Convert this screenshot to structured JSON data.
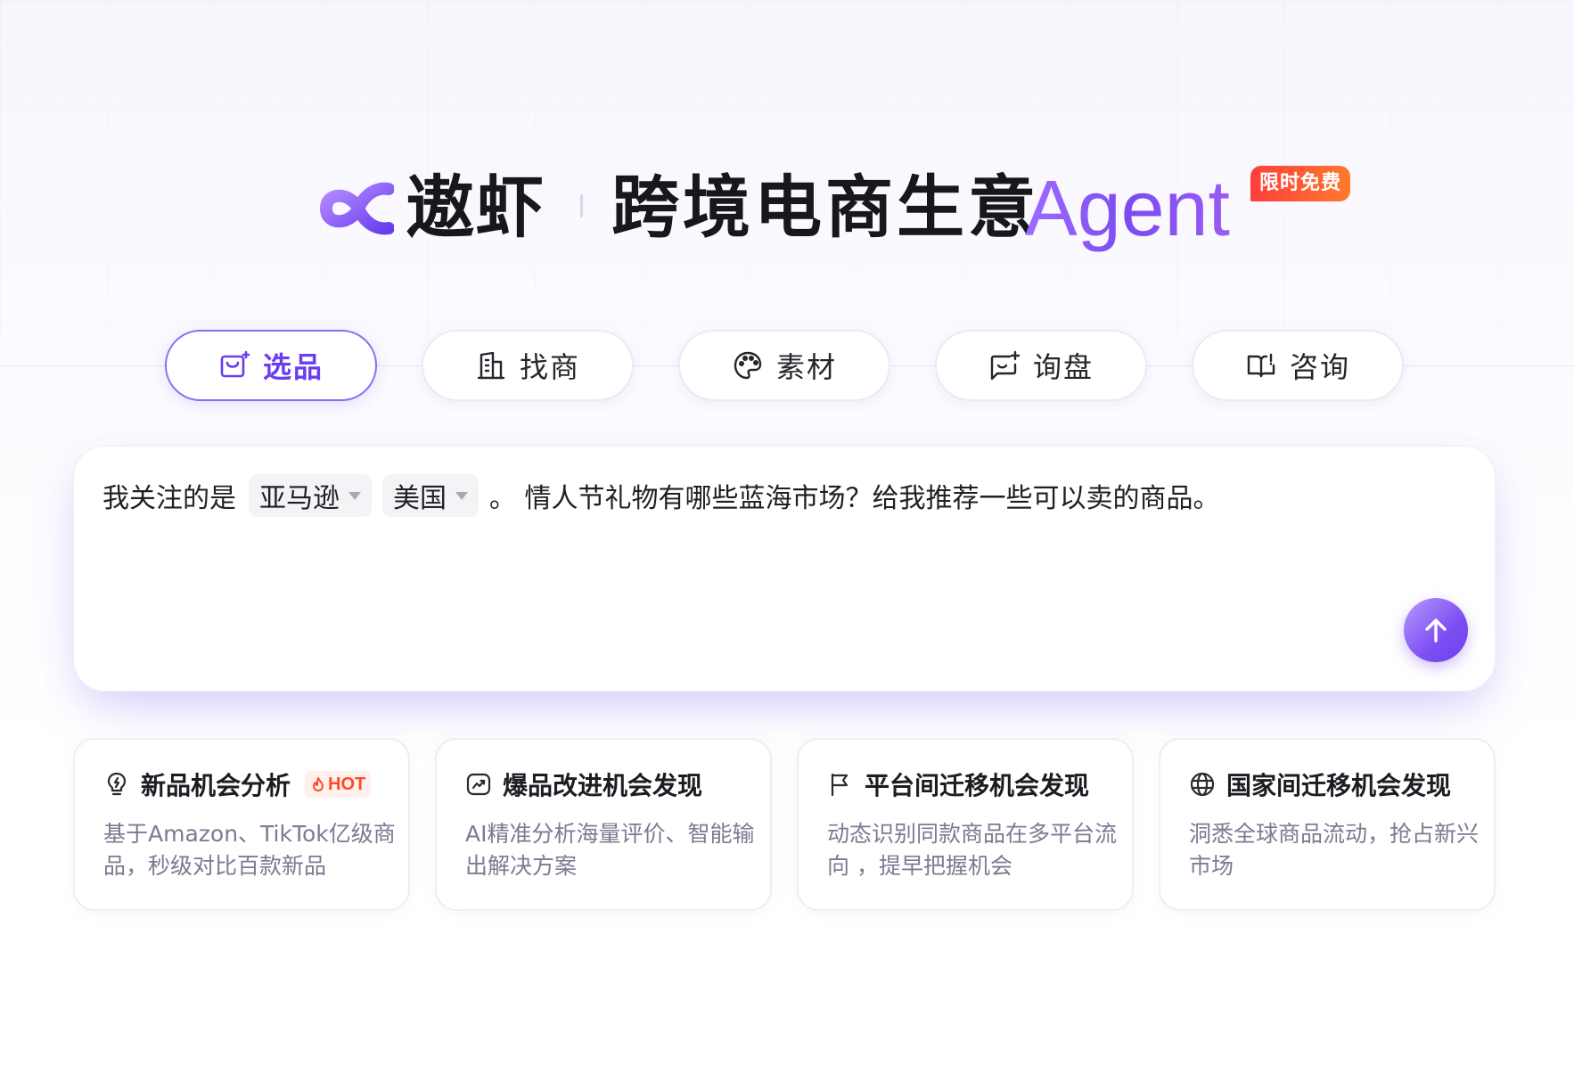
{
  "header": {
    "brand": "遨虾",
    "headline": "跨境电商生意",
    "headline_agent": "Agent",
    "badge": "限时免费"
  },
  "tabs": [
    {
      "label": "选品",
      "icon": "shopping-bag-sparkle-icon",
      "active": true
    },
    {
      "label": "找商",
      "icon": "building-icon",
      "active": false
    },
    {
      "label": "素材",
      "icon": "palette-icon",
      "active": false
    },
    {
      "label": "询盘",
      "icon": "chat-plus-icon",
      "active": false
    },
    {
      "label": "咨询",
      "icon": "book-icon",
      "active": false
    }
  ],
  "prompt": {
    "prefix": "我关注的是",
    "platform": "亚马逊",
    "country": "美国",
    "suffix": "。 情人节礼物有哪些蓝海市场？给我推荐一些可以卖的商品。"
  },
  "cards": [
    {
      "title": "新品机会分析",
      "badge": "HOT",
      "icon": "lightbulb-icon",
      "desc": "基于Amazon、TikTok亿级商品，秒级对比百款新品"
    },
    {
      "title": "爆品改进机会发现",
      "icon": "trend-chart-icon",
      "desc": "AI精准分析海量评价、智能输出解决方案"
    },
    {
      "title": "平台间迁移机会发现",
      "icon": "flag-icon",
      "desc": "动态识别同款商品在多平台流向 ，提早把握机会"
    },
    {
      "title": "国家间迁移机会发现",
      "icon": "globe-icon",
      "desc": "洞悉全球商品流动，抢占新兴市场"
    }
  ],
  "colors": {
    "accent": "#7b4cf0",
    "hot": "#ff4a2a",
    "badge_start": "#ff3d3d",
    "badge_end": "#ff7a2e"
  }
}
